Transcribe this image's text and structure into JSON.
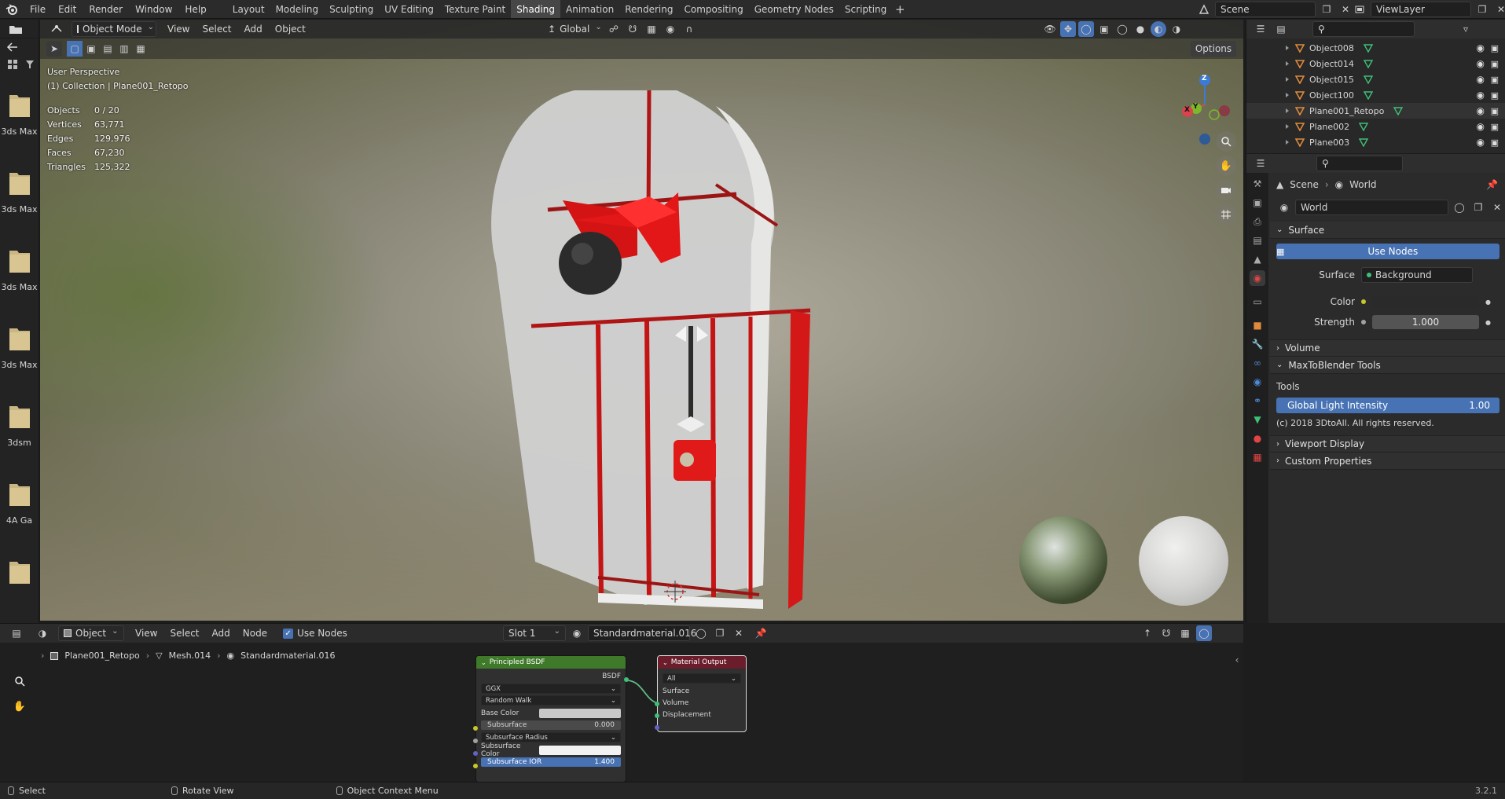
{
  "top_menu": [
    "File",
    "Edit",
    "Render",
    "Window",
    "Help"
  ],
  "workspaces": [
    "Layout",
    "Modeling",
    "Sculpting",
    "UV Editing",
    "Texture Paint",
    "Shading",
    "Animation",
    "Rendering",
    "Compositing",
    "Geometry Nodes",
    "Scripting"
  ],
  "active_workspace": "Shading",
  "scene": {
    "label": "Scene",
    "view_layer": "ViewLayer"
  },
  "viewport_header": {
    "mode": "Object Mode",
    "menus": [
      "View",
      "Select",
      "Add",
      "Object"
    ],
    "orientation": "Global",
    "options": "Options"
  },
  "viewport_overlay": {
    "perspective": "User Perspective",
    "collection": "(1) Collection | Plane001_Retopo",
    "stats": [
      {
        "label": "Objects",
        "value": "0 / 20"
      },
      {
        "label": "Vertices",
        "value": "63,771"
      },
      {
        "label": "Edges",
        "value": "129,976"
      },
      {
        "label": "Faces",
        "value": "67,230"
      },
      {
        "label": "Triangles",
        "value": "125,322"
      }
    ]
  },
  "gizmo": {
    "z": "Z",
    "y": "Y",
    "x": "X"
  },
  "file_browser": [
    "3ds Max",
    "3ds Max",
    "3ds Max",
    "3ds Max",
    "3dsm",
    "4A Ga",
    ""
  ],
  "outliner": {
    "items": [
      {
        "name": "Object008",
        "type": "mesh"
      },
      {
        "name": "Object014",
        "type": "mesh"
      },
      {
        "name": "Object015",
        "type": "mesh"
      },
      {
        "name": "Object100",
        "type": "mesh"
      },
      {
        "name": "Plane001_Retopo",
        "type": "mesh",
        "active": true
      },
      {
        "name": "Plane002",
        "type": "mesh"
      },
      {
        "name": "Plane003",
        "type": "mesh"
      }
    ]
  },
  "properties": {
    "breadcrumb": [
      "Scene",
      "World"
    ],
    "world_name": "World",
    "sections": {
      "surface": "Surface",
      "use_nodes": "Use Nodes",
      "surface_label": "Surface",
      "surface_value": "Background",
      "color_label": "Color",
      "strength_label": "Strength",
      "strength_value": "1.000",
      "volume": "Volume",
      "maxtoblender": "MaxToBlender Tools",
      "tools": "Tools",
      "global_light_label": "Global Light Intensity",
      "global_light_value": "1.00",
      "copyright": "(c) 2018 3DtoAll. All rights reserved.",
      "viewport_display": "Viewport Display",
      "custom_properties": "Custom Properties"
    }
  },
  "node_editor": {
    "header": {
      "mode": "Object",
      "menus": [
        "View",
        "Select",
        "Add",
        "Node"
      ],
      "use_nodes": "Use Nodes",
      "slot": "Slot 1",
      "material": "Standardmaterial.016"
    },
    "breadcrumb": [
      "Plane001_Retopo",
      "Mesh.014",
      "Standardmaterial.016"
    ],
    "bsdf": {
      "title": "Principled BSDF",
      "output": "BSDF",
      "distribution": "GGX",
      "subsurface_method": "Random Walk",
      "base_color": "Base Color",
      "subsurface": "Subsurface",
      "subsurface_value": "0.000",
      "subsurface_radius": "Subsurface Radius",
      "subsurface_color": "Subsurface Color",
      "subsurface_ior": "Subsurface IOR",
      "subsurface_ior_value": "1.400"
    },
    "output": {
      "title": "Material Output",
      "target": "All",
      "sockets": [
        "Surface",
        "Volume",
        "Displacement"
      ]
    }
  },
  "status_bar": {
    "select": "Select",
    "rotate": "Rotate View",
    "context": "Object Context Menu",
    "version": "3.2.1"
  },
  "colors": {
    "accent_blue": "#4772b3",
    "active_tab": "#474747",
    "bsdf_header": "#3f7a2a",
    "output_header": "#6b1d2b",
    "mesh_orange": "#e08a3c",
    "data_green": "#3fbf78"
  }
}
